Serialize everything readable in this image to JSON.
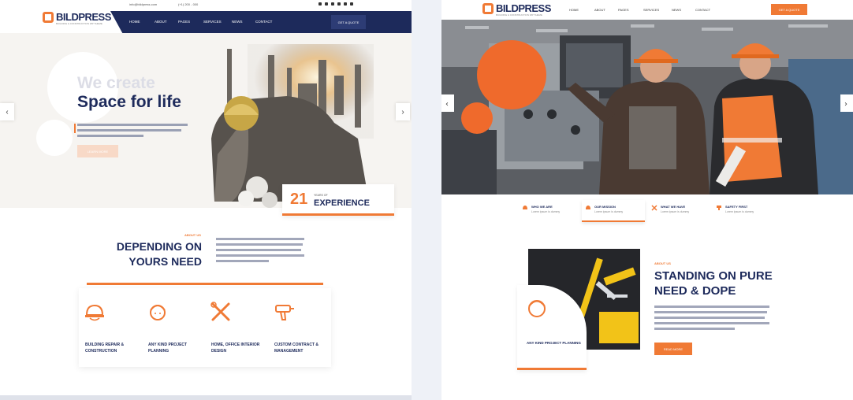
{
  "left": {
    "logo": {
      "name": "BILDPRESS",
      "tagline": "BUILDING & CONSTRUCTION WP THEME"
    },
    "topbar": {
      "email": "info@bildpress.com",
      "phone": "(+1) 200 - 000"
    },
    "nav": {
      "items": [
        "HOME",
        "ABOUT",
        "PAGES",
        "SERVICES",
        "NEWS",
        "CONTACT"
      ],
      "cta": "GET A QUOTE"
    },
    "hero": {
      "line1": "We create",
      "line2": "Space for life",
      "button": "LEARN MORE"
    },
    "experience": {
      "number": "21",
      "label_small": "YEARS OF",
      "label_big": "EXPERIENCE"
    },
    "about": {
      "tag": "ABOUT US",
      "title_line1": "DEPENDING ON",
      "title_line2": "YOURS NEED"
    },
    "services": [
      {
        "label": "BUILDING REPAIR & CONSTRUCTION",
        "icon": "helmet-icon"
      },
      {
        "label": "ANY KIND PROJECT PLANNING",
        "icon": "worker-icon"
      },
      {
        "label": "HOME, OFFICE INTERIOR DESIGN",
        "icon": "tools-icon"
      },
      {
        "label": "CUSTOM CONTRACT & MANAGEMENT",
        "icon": "drill-icon"
      }
    ]
  },
  "right": {
    "logo": {
      "name": "BILDPRESS",
      "tagline": "BUILDING & CONSTRUCTION WP THEME"
    },
    "nav": {
      "items": [
        "HOME",
        "ABOUT",
        "PAGES",
        "SERVICES",
        "NEWS",
        "CONTACT"
      ],
      "cta": "GET A QUOTE"
    },
    "features": [
      {
        "title": "WHO WE ARE",
        "sub": "Lorem ipsum is dummy"
      },
      {
        "title": "OUR MISSION",
        "sub": "Lorem ipsum is dummy"
      },
      {
        "title": "WHAT WE HAVE",
        "sub": "Lorem ipsum is dummy"
      },
      {
        "title": "SAFETY FIRST",
        "sub": "Lorem ipsum is dummy"
      }
    ],
    "card": {
      "label": "ANY KIND PROJECT PLANNING"
    },
    "about": {
      "tag": "ABOUT US",
      "title_line1": "STANDING ON PURE",
      "title_line2": "NEED & DOPE",
      "button": "READ MORE"
    }
  },
  "colors": {
    "accent": "#f07a35",
    "navy": "#1d2a5b"
  }
}
